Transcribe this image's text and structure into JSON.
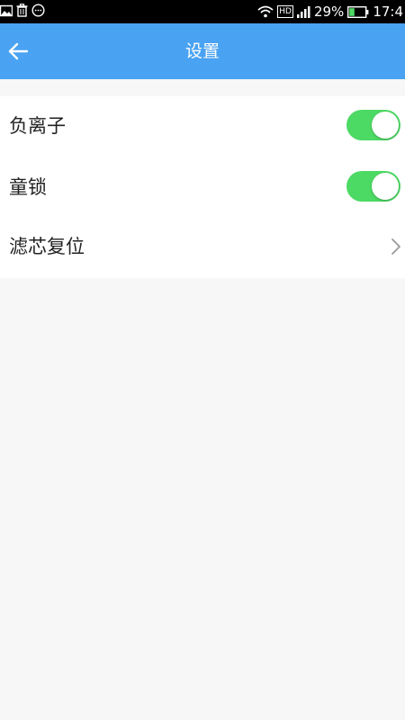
{
  "status_bar": {
    "battery_percent": "29%",
    "time": "17:4",
    "network_label": "HD"
  },
  "header": {
    "title": "设置"
  },
  "settings": {
    "items": [
      {
        "label": "负离子",
        "toggle_on": true
      },
      {
        "label": "童锁",
        "toggle_on": true
      },
      {
        "label": "滤芯复位"
      }
    ]
  },
  "colors": {
    "header_bg": "#4aa2f2",
    "toggle_on": "#4cd964",
    "page_bg": "#f7f7f7"
  },
  "icons": {
    "back": "arrow-left-icon",
    "chevron": "chevron-right-icon"
  }
}
